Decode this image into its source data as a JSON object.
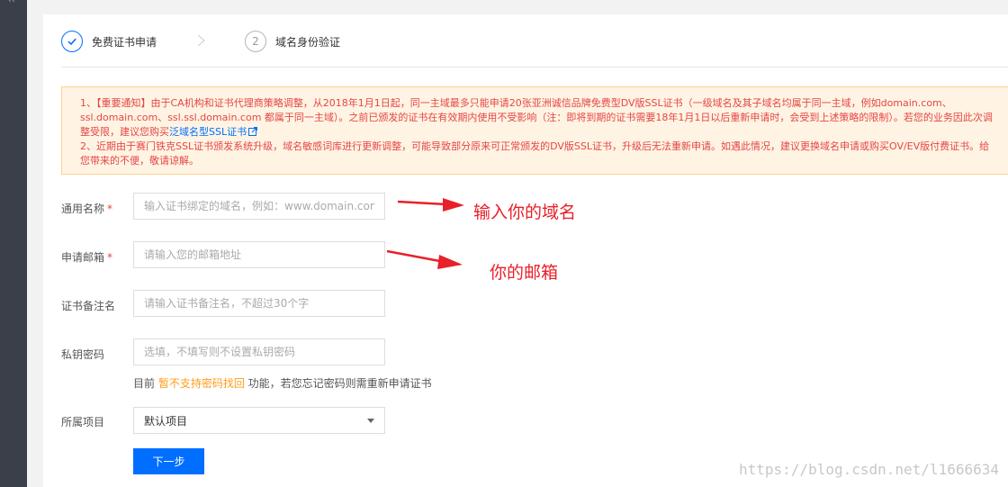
{
  "steps": [
    {
      "number": "1",
      "label": "免费证书申请",
      "state": "completed"
    },
    {
      "number": "2",
      "label": "域名身份验证",
      "state": "pending"
    }
  ],
  "notice": {
    "p1_prefix": "1、【重要通知】由于CA机构和证书代理商策略调整，从2018年1月1日起，同一主域最多只能申请20张亚洲诚信品牌免费型DV版SSL证书（一级域名及其子域名均属于同一主域，例如domain.com、ssl.domain.com、ssl.ssl.domain.com 都属于同一主域）。之前已颁发的证书在有效期内使用不受影响（注：即将到期的证书需要18年1月1日以后重新申请时，会受到上述策略的限制）。若您的业务因此次调整受限，建议您购买",
    "p1_link": "泛域名型SSL证书",
    "p2": "2、近期由于赛门铁克SSL证书颁发系统升级，域名敏感词库进行更新调整，可能导致部分原来可正常颁发的DV版SSL证书，升级后无法重新申请。如遇此情况，建议更换域名申请或购买OV/EV版付费证书。给您带来的不便，敬请谅解。"
  },
  "form": {
    "domain": {
      "label": "通用名称",
      "required_mark": "*",
      "placeholder": "输入证书绑定的域名，例如：www.domain.com",
      "value": ""
    },
    "email": {
      "label": "申请邮箱",
      "required_mark": "*",
      "placeholder": "请输入您的邮箱地址",
      "value": ""
    },
    "remark": {
      "label": "证书备注名",
      "placeholder": "请输入证书备注名，不超过30个字",
      "value": ""
    },
    "key_password": {
      "label": "私钥密码",
      "placeholder": "选填，不填写则不设置私钥密码",
      "value": ""
    },
    "hint": {
      "prefix": "目前 ",
      "warning": "暂不支持密码找回",
      "suffix": " 功能，若您忘记密码则需重新申请证书"
    },
    "project": {
      "label": "所属项目",
      "selected": "默认项目"
    },
    "next_button": "下一步"
  },
  "annotations": {
    "domain_note": "输入你的域名",
    "email_note": "你的邮箱"
  },
  "watermark": "https://blog.csdn.net/l1666634",
  "colors": {
    "primary": "#006eff",
    "danger": "#e54545",
    "warning": "#ff9c19",
    "annotation": "#e8202a"
  }
}
